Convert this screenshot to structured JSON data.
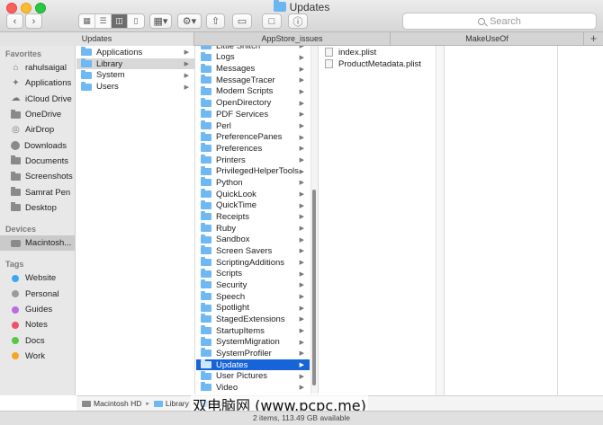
{
  "window": {
    "title": "Updates"
  },
  "search": {
    "placeholder": "Search"
  },
  "tabs": [
    {
      "label": "Updates",
      "active": true
    },
    {
      "label": "AppStore_issues",
      "active": false
    },
    {
      "label": "MakeUseOf",
      "active": false
    }
  ],
  "sidebar": {
    "favorites_header": "Favorites",
    "favorites": [
      {
        "label": "rahulsaigal",
        "icon": "home-icon"
      },
      {
        "label": "Applications",
        "icon": "applications-icon"
      },
      {
        "label": "iCloud Drive",
        "icon": "cloud-icon"
      },
      {
        "label": "OneDrive",
        "icon": "folder-icon"
      },
      {
        "label": "AirDrop",
        "icon": "airdrop-icon"
      },
      {
        "label": "Downloads",
        "icon": "downloads-icon"
      },
      {
        "label": "Documents",
        "icon": "folder-icon"
      },
      {
        "label": "Screenshots",
        "icon": "folder-icon"
      },
      {
        "label": "Samrat Pen",
        "icon": "folder-icon"
      },
      {
        "label": "Desktop",
        "icon": "folder-icon"
      }
    ],
    "devices_header": "Devices",
    "devices": [
      {
        "label": "Macintosh...",
        "icon": "disk-icon"
      }
    ],
    "tags_header": "Tags",
    "tags": [
      {
        "label": "Website",
        "color": "#3aa8f0"
      },
      {
        "label": "Personal",
        "color": "#9b9b9b"
      },
      {
        "label": "Guides",
        "color": "#b66ee0"
      },
      {
        "label": "Notes",
        "color": "#f0506a"
      },
      {
        "label": "Docs",
        "color": "#55c940"
      },
      {
        "label": "Work",
        "color": "#f5a623"
      }
    ]
  },
  "column1": {
    "items": [
      "Applications",
      "Library",
      "System",
      "Users"
    ],
    "selected": 1
  },
  "column2": {
    "items": [
      "Little Snitch",
      "Logs",
      "Messages",
      "MessageTracer",
      "Modem Scripts",
      "OpenDirectory",
      "PDF Services",
      "Perl",
      "PreferencePanes",
      "Preferences",
      "Printers",
      "PrivilegedHelperTools",
      "Python",
      "QuickLook",
      "QuickTime",
      "Receipts",
      "Ruby",
      "Sandbox",
      "Screen Savers",
      "ScriptingAdditions",
      "Scripts",
      "Security",
      "Speech",
      "Spotlight",
      "StagedExtensions",
      "StartupItems",
      "SystemMigration",
      "SystemProfiler",
      "Updates",
      "User Pictures",
      "Video"
    ],
    "selected": 28
  },
  "column3": {
    "items": [
      "index.plist",
      "ProductMetadata.plist"
    ]
  },
  "pathbar": {
    "items": [
      "Macintosh HD",
      "Library",
      "Up"
    ]
  },
  "status": {
    "text": "2 items, 113.49 GB available"
  },
  "watermark": {
    "text": "电脑网 (www.pcpc.me)",
    "prefix": "双"
  },
  "colors": {
    "selection": "#1664d8",
    "folder": "#6eb8f4"
  }
}
